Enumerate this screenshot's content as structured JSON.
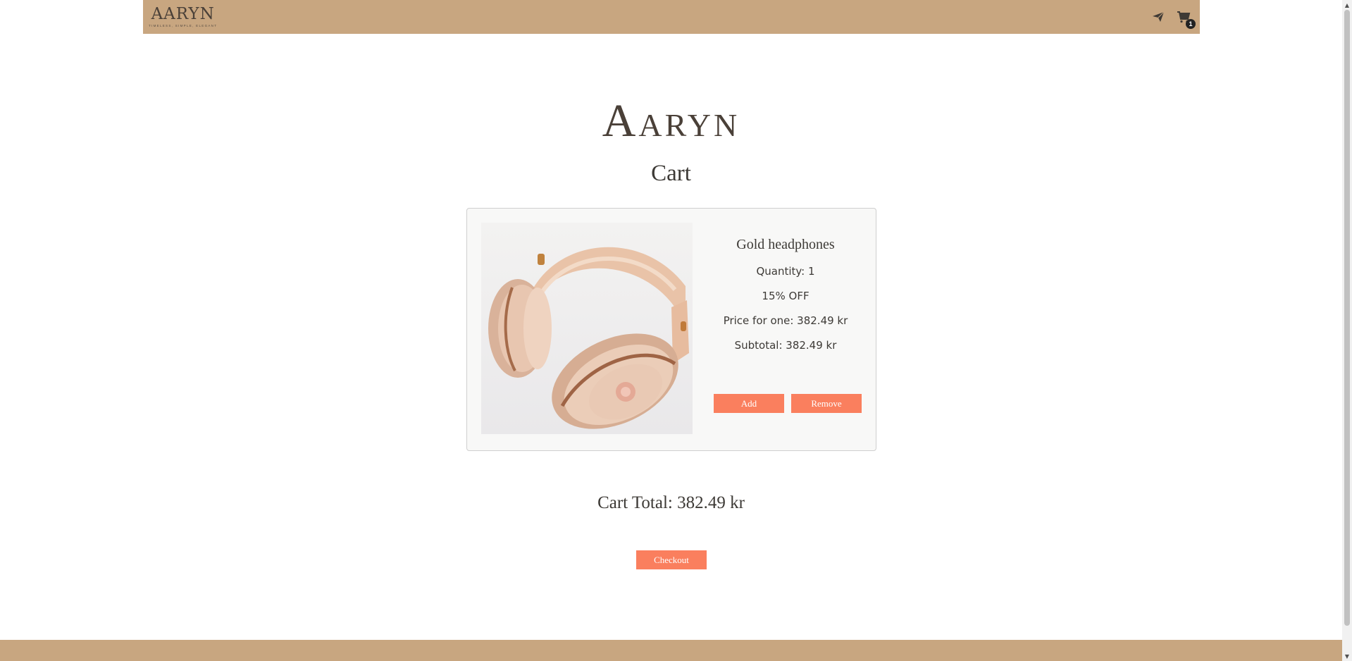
{
  "nav": {
    "logo_text": "AARYN",
    "logo_tagline": "Timeless, Simple, Elegant",
    "send_icon": "paper-plane-icon",
    "cart_icon": "shopping-cart-icon",
    "cart_count": "1"
  },
  "brand": {
    "title": "Aaryn"
  },
  "page": {
    "title": "Cart"
  },
  "cart_item": {
    "image_alt": "Gold headphones",
    "name": "Gold headphones",
    "quantity": "Quantity: 1",
    "discount": "15% OFF",
    "price_each": "Price for one: 382.49 kr",
    "subtotal": "Subtotal: 382.49 kr",
    "add_label": "Add",
    "remove_label": "Remove"
  },
  "cart_total": "Cart Total: 382.49 kr",
  "checkout_label": "Checkout",
  "colors": {
    "nav_bg": "#c8a680",
    "button_bg": "#fa7f5e",
    "text": "#3d3a36"
  }
}
